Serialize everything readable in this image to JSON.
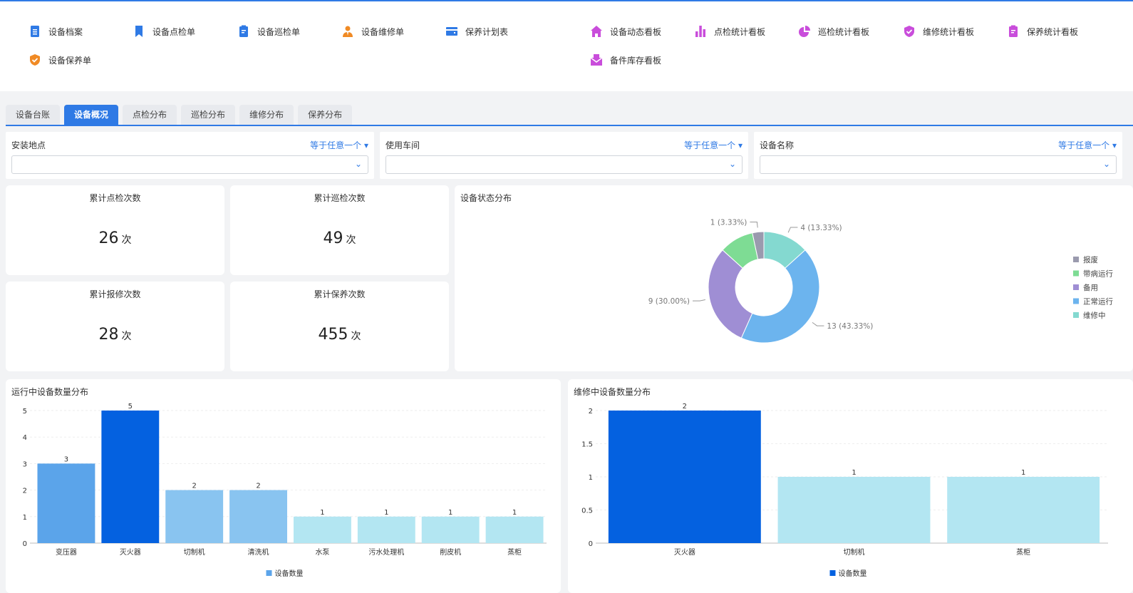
{
  "nav": [
    {
      "label": "设备档案",
      "icon": "document-icon",
      "color": "#2f7ae5"
    },
    {
      "label": "设备点检单",
      "icon": "bookmark-icon",
      "color": "#2f7ae5"
    },
    {
      "label": "设备巡检单",
      "icon": "clipboard-icon",
      "color": "#2f7ae5"
    },
    {
      "label": "设备维修单",
      "icon": "worker-icon",
      "color": "#f08a24"
    },
    {
      "label": "保养计划表",
      "icon": "card-icon",
      "color": "#2f7ae5"
    },
    {
      "label": "设备保养单",
      "icon": "shield-check-icon",
      "color": "#f08a24"
    },
    {
      "label": "设备动态看板",
      "icon": "home-icon",
      "color": "#c94ddb"
    },
    {
      "label": "点检统计看板",
      "icon": "bar-chart-icon",
      "color": "#c94ddb"
    },
    {
      "label": "巡检统计看板",
      "icon": "pie-chart-icon",
      "color": "#c94ddb"
    },
    {
      "label": "维修统计看板",
      "icon": "shield-check-icon",
      "color": "#c94ddb"
    },
    {
      "label": "保养统计看板",
      "icon": "clipboard-icon",
      "color": "#c94ddb"
    },
    {
      "label": "备件库存看板",
      "icon": "inbox-icon",
      "color": "#c94ddb"
    }
  ],
  "tabs": [
    "设备台账",
    "设备概况",
    "点检分布",
    "巡检分布",
    "维修分布",
    "保养分布"
  ],
  "filters": [
    {
      "label": "安装地点",
      "op": "等于任意一个"
    },
    {
      "label": "使用车间",
      "op": "等于任意一个"
    },
    {
      "label": "设备名称",
      "op": "等于任意一个"
    }
  ],
  "kpis": [
    {
      "title": "累计点检次数",
      "value": "26",
      "unit": "次"
    },
    {
      "title": "累计巡检次数",
      "value": "49",
      "unit": "次"
    },
    {
      "title": "累计报修次数",
      "value": "28",
      "unit": "次"
    },
    {
      "title": "累计保养次数",
      "value": "455",
      "unit": "次"
    }
  ],
  "chart_data": [
    {
      "type": "pie",
      "title": "设备状态分布",
      "donut": true,
      "legend": "right",
      "slices": [
        {
          "name": "维修中",
          "value": 4,
          "label": "4 (13.33%)",
          "color": "#84d9d0"
        },
        {
          "name": "正常运行",
          "value": 13,
          "label": "13 (43.33%)",
          "color": "#6cb4ee"
        },
        {
          "name": "备用",
          "value": 9,
          "label": "9 (30.00%)",
          "color": "#9f8ed4"
        },
        {
          "name": "带病运行",
          "value": 3,
          "label": "",
          "color": "#7edc94"
        },
        {
          "name": "报废",
          "value": 1,
          "label": "1 (3.33%)",
          "color": "#9a9aae"
        }
      ],
      "legend_order": [
        "报废",
        "带病运行",
        "备用",
        "正常运行",
        "维修中"
      ]
    },
    {
      "type": "bar",
      "title": "运行中设备数量分布",
      "categories": [
        "变压器",
        "灭火器",
        "切制机",
        "清洗机",
        "水泵",
        "污水处理机",
        "削皮机",
        "蒸柜"
      ],
      "values": [
        3,
        5,
        2,
        2,
        1,
        1,
        1,
        1
      ],
      "colors": [
        "#5ba4ea",
        "#0461e0",
        "#89c4f0",
        "#89c4f0",
        "#b3e6f2",
        "#b3e6f2",
        "#b3e6f2",
        "#b3e6f2"
      ],
      "yticks": [
        "0",
        "1",
        "2",
        "3",
        "4",
        "5"
      ],
      "ylim": [
        0,
        5
      ],
      "legend": "设备数量",
      "legend_color": "#5ba4ea"
    },
    {
      "type": "bar",
      "title": "维修中设备数量分布",
      "categories": [
        "灭火器",
        "切制机",
        "蒸柜"
      ],
      "values": [
        2,
        1,
        1
      ],
      "colors": [
        "#0461e0",
        "#b3e6f2",
        "#b3e6f2"
      ],
      "yticks": [
        "0",
        "0.5",
        "1",
        "1.5",
        "2"
      ],
      "ylim": [
        0,
        2
      ],
      "legend": "设备数量",
      "legend_color": "#0461e0"
    }
  ]
}
